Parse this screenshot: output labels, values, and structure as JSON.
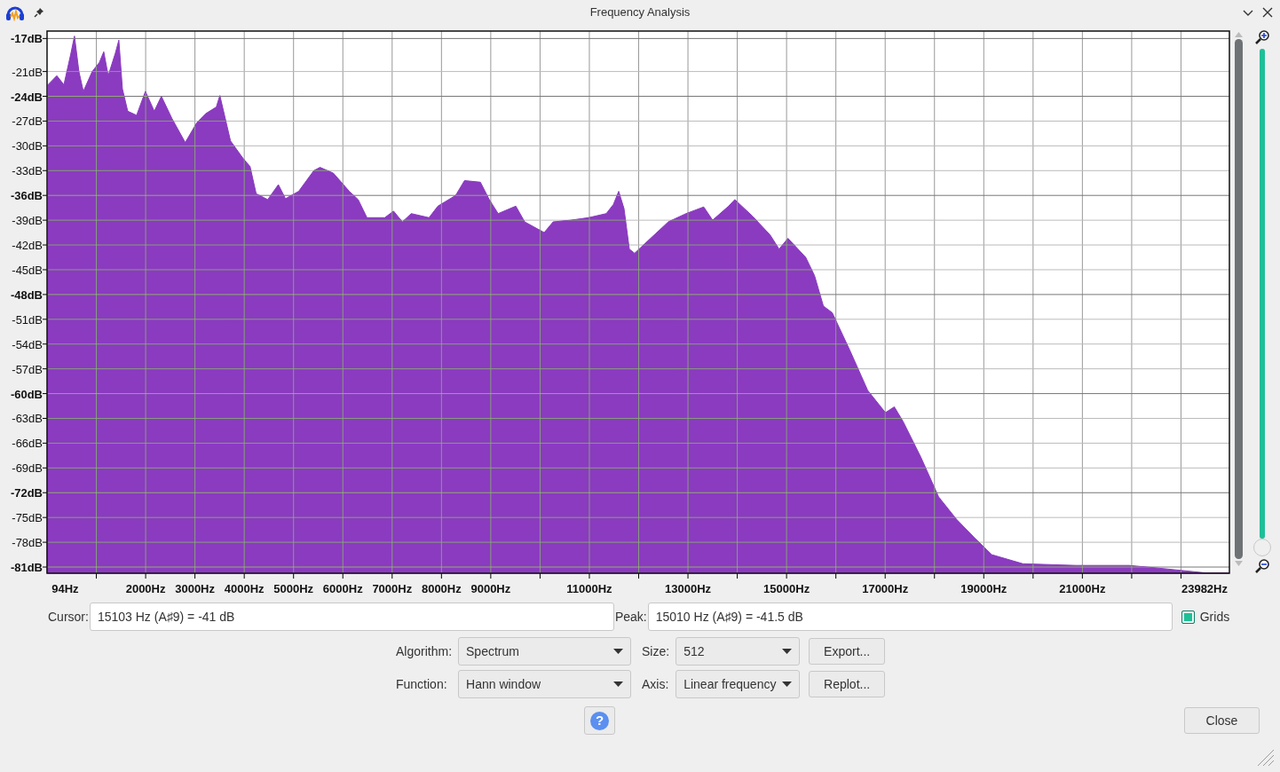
{
  "window": {
    "title": "Frequency Analysis"
  },
  "spectrum": {
    "chart_data": {
      "type": "area",
      "xlim": [
        0,
        23982
      ],
      "ylim": [
        -81.75,
        -16.1
      ],
      "grid": true,
      "xticks": [
        {
          "value": 94,
          "label": "94Hz"
        },
        {
          "value": 2000,
          "label": "2000Hz"
        },
        {
          "value": 3000,
          "label": "3000Hz"
        },
        {
          "value": 4000,
          "label": "4000Hz"
        },
        {
          "value": 5000,
          "label": "5000Hz"
        },
        {
          "value": 6000,
          "label": "6000Hz"
        },
        {
          "value": 7000,
          "label": "7000Hz"
        },
        {
          "value": 8000,
          "label": "8000Hz"
        },
        {
          "value": 9000,
          "label": "9000Hz"
        },
        {
          "value": 11000,
          "label": "11000Hz"
        },
        {
          "value": 13000,
          "label": "13000Hz"
        },
        {
          "value": 15000,
          "label": "15000Hz"
        },
        {
          "value": 17000,
          "label": "17000Hz"
        },
        {
          "value": 19000,
          "label": "19000Hz"
        },
        {
          "value": 21000,
          "label": "21000Hz"
        },
        {
          "value": 23982,
          "label": "23982Hz"
        }
      ],
      "yticks": [
        {
          "value": -17,
          "label": "-17dB"
        },
        {
          "value": -21,
          "label": "-21dB"
        },
        {
          "value": -24,
          "label": "-24dB"
        },
        {
          "value": -27,
          "label": "-27dB"
        },
        {
          "value": -30,
          "label": "-30dB"
        },
        {
          "value": -33,
          "label": "-33dB"
        },
        {
          "value": -36,
          "label": "-36dB"
        },
        {
          "value": -39,
          "label": "-39dB"
        },
        {
          "value": -42,
          "label": "-42dB"
        },
        {
          "value": -45,
          "label": "-45dB"
        },
        {
          "value": -48,
          "label": "-48dB"
        },
        {
          "value": -51,
          "label": "-51dB"
        },
        {
          "value": -54,
          "label": "-54dB"
        },
        {
          "value": -57,
          "label": "-57dB"
        },
        {
          "value": -60,
          "label": "-60dB"
        },
        {
          "value": -63,
          "label": "-63dB"
        },
        {
          "value": -66,
          "label": "-66dB"
        },
        {
          "value": -69,
          "label": "-69dB"
        },
        {
          "value": -72,
          "label": "-72dB"
        },
        {
          "value": -75,
          "label": "-75dB"
        },
        {
          "value": -78,
          "label": "-78dB"
        },
        {
          "value": -81,
          "label": "-81dB"
        }
      ],
      "x": [
        0,
        20,
        198,
        342,
        485,
        557,
        647,
        737,
        917,
        1061,
        1150,
        1240,
        1384,
        1456,
        1528,
        1636,
        1816,
        1995,
        2175,
        2319,
        2535,
        2804,
        3038,
        3218,
        3433,
        3505,
        3721,
        3973,
        4117,
        4242,
        4476,
        4692,
        4836,
        5105,
        5411,
        5537,
        5806,
        6130,
        6310,
        6489,
        6849,
        7029,
        7208,
        7388,
        7748,
        7928,
        8287,
        8467,
        8790,
        8970,
        9150,
        9509,
        9689,
        10085,
        10264,
        10624,
        10983,
        11343,
        11487,
        11595,
        11703,
        11811,
        11918,
        12242,
        12601,
        12961,
        13320,
        13500,
        13824,
        13949,
        14309,
        14668,
        14848,
        15028,
        15388,
        15567,
        15747,
        15927,
        16287,
        16646,
        17005,
        17185,
        17365,
        17724,
        18084,
        18443,
        18803,
        19163,
        19792,
        20870,
        21949,
        22668,
        23478,
        23982
      ],
      "series": [
        {
          "color": "#8a3bbf",
          "values": [
            -81.75,
            -22.6,
            -21.5,
            -22.6,
            -18.8,
            -16.7,
            -21.0,
            -23.4,
            -21.0,
            -19.9,
            -18.6,
            -21.5,
            -18.8,
            -17.2,
            -23.1,
            -25.8,
            -26.3,
            -23.4,
            -25.8,
            -24.0,
            -26.7,
            -29.6,
            -27.2,
            -26.1,
            -25.3,
            -23.9,
            -29.4,
            -31.5,
            -32.5,
            -35.8,
            -36.5,
            -34.7,
            -36.4,
            -35.5,
            -33.0,
            -32.6,
            -33.3,
            -35.5,
            -36.5,
            -38.7,
            -38.7,
            -37.9,
            -39.2,
            -38.2,
            -38.7,
            -37.3,
            -36.0,
            -34.2,
            -34.4,
            -36.5,
            -38.2,
            -37.3,
            -39.2,
            -40.5,
            -39.2,
            -39.0,
            -38.7,
            -38.2,
            -37.1,
            -35.5,
            -37.6,
            -42.5,
            -43.0,
            -41.2,
            -39.2,
            -38.2,
            -37.4,
            -39.0,
            -37.3,
            -36.5,
            -38.5,
            -40.8,
            -42.5,
            -41.2,
            -43.5,
            -45.7,
            -49.4,
            -50.2,
            -54.8,
            -59.6,
            -62.3,
            -61.6,
            -63.4,
            -67.7,
            -72.5,
            -75.2,
            -77.4,
            -79.5,
            -80.6,
            -80.8,
            -80.8,
            -81.2,
            -81.7,
            -81.7
          ]
        }
      ]
    }
  },
  "zoom_slider": {
    "level": 0
  },
  "cursor": {
    "label": "Cursor:",
    "value": "15103 Hz (A♯9) = -41 dB"
  },
  "peak": {
    "label": "Peak:",
    "value": "15010 Hz (A♯9) = -41.5 dB"
  },
  "grids": {
    "label": "Grids",
    "checked": true
  },
  "algorithm": {
    "label": "Algorithm:",
    "value": "Spectrum"
  },
  "size": {
    "label": "Size:",
    "value": "512"
  },
  "export_button": {
    "label": "Export..."
  },
  "function": {
    "label": "Function:",
    "value": "Hann window"
  },
  "axis": {
    "label": "Axis:",
    "value": "Linear frequency"
  },
  "replot_button": {
    "label": "Replot..."
  },
  "help_button": {
    "text": "?"
  },
  "close_button": {
    "label": "Close"
  }
}
